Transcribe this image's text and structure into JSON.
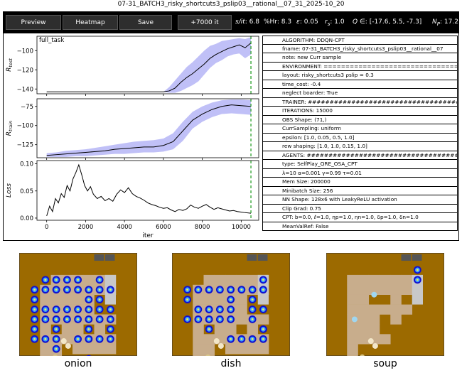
{
  "window": {
    "title": "07-31_BATCH3_risky_shortcuts3_pslip03__rational__07_31_2025-10_20"
  },
  "toolbar": {
    "buttons": [
      {
        "label": "Preview"
      },
      {
        "label": "Heatmap"
      },
      {
        "label": "Save"
      },
      {
        "label": "+7000 it"
      }
    ],
    "stats": [
      {
        "key": "s/it",
        "value": "6.8"
      },
      {
        "key": "%Hr",
        "value": "8.3"
      },
      {
        "key": "ε",
        "value": "0.05"
      },
      {
        "key": "r_s",
        "value": "1.0"
      },
      {
        "key": "Q ∈",
        "value": "[-17.6, 5.5, -7.3]"
      },
      {
        "key": "N_P",
        "value": "17.2"
      }
    ]
  },
  "chart_data": [
    {
      "type": "line",
      "panel": "test",
      "annotation": "full_task",
      "ylabel": "R_test",
      "xlim": [
        -500,
        10900
      ],
      "ylim": [
        -145,
        -85
      ],
      "yticks": [
        -100,
        -120,
        -140
      ],
      "marker_x": 10500,
      "series": [
        {
          "x": [
            0,
            1000,
            2000,
            3000,
            4000,
            5000,
            6000,
            6300,
            6600,
            6900,
            7200,
            7500,
            7800,
            8100,
            8400,
            8700,
            9000,
            9300,
            9600,
            9900,
            10200,
            10500
          ],
          "y": [
            -143,
            -143,
            -143,
            -143,
            -143,
            -143,
            -143,
            -142,
            -139,
            -133,
            -128,
            -124,
            -119,
            -114,
            -108,
            -104,
            -101,
            -98,
            -96,
            -94,
            -97,
            -92
          ],
          "band_low": [
            -143,
            -143,
            -143,
            -143,
            -143,
            -143,
            -143,
            -144,
            -144,
            -142,
            -139,
            -136,
            -132,
            -125,
            -118,
            -113,
            -110,
            -106,
            -104,
            -103,
            -108,
            -104
          ],
          "band_high": [
            -143,
            -143,
            -143,
            -143,
            -143,
            -143,
            -143,
            -138,
            -131,
            -124,
            -117,
            -112,
            -106,
            -100,
            -95,
            -93,
            -90,
            -89,
            -88,
            -87,
            -88,
            -86
          ]
        }
      ]
    },
    {
      "type": "line",
      "panel": "train",
      "ylabel": "R_train",
      "xlim": [
        -500,
        10900
      ],
      "ylim": [
        -142,
        -65
      ],
      "yticks": [
        -75,
        -100,
        -125
      ],
      "marker_x": 10500,
      "series": [
        {
          "x": [
            0,
            500,
            1000,
            1500,
            2000,
            2500,
            3000,
            3500,
            4000,
            4500,
            5000,
            5500,
            6000,
            6500,
            7000,
            7500,
            8000,
            8500,
            9000,
            9500,
            10000,
            10500
          ],
          "y": [
            -139,
            -138,
            -137,
            -136,
            -135,
            -134,
            -133,
            -131,
            -130,
            -129,
            -128,
            -128,
            -126,
            -121,
            -107,
            -93,
            -85,
            -79,
            -75,
            -73,
            -74,
            -75
          ],
          "band_low": [
            -141,
            -141,
            -141,
            -140,
            -140,
            -139,
            -138,
            -137,
            -137,
            -136,
            -135,
            -135,
            -134,
            -131,
            -120,
            -104,
            -95,
            -89,
            -85,
            -84,
            -85,
            -86
          ],
          "band_high": [
            -136,
            -135,
            -133,
            -132,
            -131,
            -129,
            -127,
            -125,
            -123,
            -121,
            -120,
            -119,
            -117,
            -110,
            -95,
            -82,
            -75,
            -70,
            -67,
            -66,
            -66,
            -67
          ]
        }
      ]
    },
    {
      "type": "line",
      "panel": "loss",
      "ylabel": "Loss",
      "xlabel": "iter",
      "xlim": [
        -500,
        10900
      ],
      "ylim": [
        -0.004,
        0.106
      ],
      "xticks": [
        0,
        2000,
        4000,
        6000,
        8000,
        10000
      ],
      "yticks": [
        0.0,
        0.05,
        0.1
      ],
      "marker_x": 10500,
      "series": [
        {
          "x": [
            0,
            150,
            300,
            450,
            600,
            750,
            900,
            1050,
            1200,
            1350,
            1500,
            1650,
            1800,
            1950,
            2100,
            2250,
            2400,
            2600,
            2800,
            3000,
            3200,
            3400,
            3600,
            3800,
            4000,
            4200,
            4400,
            4600,
            4800,
            5000,
            5200,
            5400,
            5600,
            5800,
            6000,
            6200,
            6400,
            6600,
            6800,
            7000,
            7200,
            7400,
            7600,
            7800,
            8000,
            8200,
            8400,
            8600,
            8800,
            9000,
            9200,
            9400,
            9600,
            9800,
            10000,
            10200,
            10500
          ],
          "y": [
            0.004,
            0.022,
            0.012,
            0.036,
            0.028,
            0.045,
            0.038,
            0.06,
            0.05,
            0.072,
            0.084,
            0.098,
            0.08,
            0.06,
            0.05,
            0.058,
            0.044,
            0.036,
            0.04,
            0.032,
            0.036,
            0.031,
            0.044,
            0.052,
            0.047,
            0.056,
            0.045,
            0.04,
            0.037,
            0.033,
            0.028,
            0.025,
            0.023,
            0.02,
            0.018,
            0.019,
            0.015,
            0.012,
            0.016,
            0.014,
            0.017,
            0.024,
            0.02,
            0.018,
            0.022,
            0.025,
            0.02,
            0.016,
            0.019,
            0.017,
            0.015,
            0.013,
            0.014,
            0.012,
            0.011,
            0.01,
            0.009
          ]
        }
      ]
    }
  ],
  "config": {
    "rows": [
      "ALGORITHM: DDQN-CPT",
      "fname: 07-31_BATCH3_risky_shortcuts3_pslip03__rational__07",
      "note: new Curr sample",
      "ENVIRONMENT: ==================================",
      "layout: risky_shortcuts3 ρslip = 0.3",
      "time_cost: -0.4",
      "neglect boarder: True",
      "TRAINER: ####################################",
      "ITERATIONS: 15000",
      "OBS Shape: (71,)",
      "CurrSampling: uniform",
      "epsilon: [1.0, 0.05, 0.5, 1.0]",
      "rew shaping: [1.0, 1.0, 0.15, 1.0]",
      "AGENTS: #####################################",
      "type: SelfPlay_QRE_OSA_CPT",
      "  λ=10  α=0.001  γ=0.99   τ=0.01",
      "Mem Size: 200000",
      "Minibatch Size: 256",
      "NN Shape: 128x6 with LeakyReLU activation",
      "Clip Grad: 0.75",
      "CPT: b=0.0, ℓ=1.0, ηp=1.0, ηn=1.0, δp=1.0, δn=1.0",
      "MeanValRef: False"
    ]
  },
  "grids": [
    {
      "caption": "onion"
    },
    {
      "caption": "dish"
    },
    {
      "caption": "soup"
    }
  ],
  "colors": {
    "line": "#000000",
    "band": "#8c8cf0",
    "marker": "#2ca02c",
    "floor": "#c8ad8c",
    "counter": "#9c6a00",
    "pot": "#555555",
    "serve": "#c8c8c8"
  }
}
